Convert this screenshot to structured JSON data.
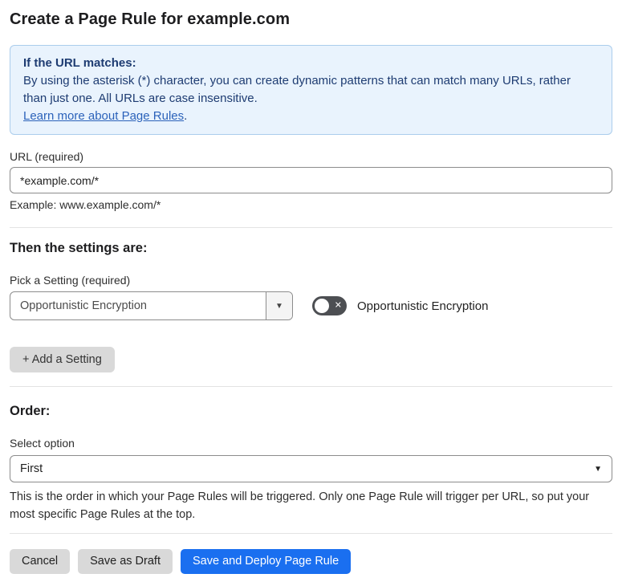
{
  "title": "Create a Page Rule for example.com",
  "info_box": {
    "heading": "If the URL matches:",
    "body": "By using the asterisk (*) character, you can create dynamic patterns that can match many URLs, rather than just one. All URLs are case insensitive.",
    "link_label": "Learn more about Page Rules",
    "link_suffix": "."
  },
  "url_section": {
    "label": "URL (required)",
    "value": "*example.com/*",
    "helper": "Example: www.example.com/*"
  },
  "settings_section": {
    "heading": "Then the settings are:",
    "pick_label": "Pick a Setting (required)",
    "selected_setting": "Opportunistic Encryption",
    "toggle_label": "Opportunistic Encryption",
    "toggle_state": "off",
    "add_button_label": "+ Add a Setting"
  },
  "order_section": {
    "heading": "Order:",
    "label": "Select option",
    "selected": "First",
    "helper": "This is the order in which your Page Rules will be triggered. Only one Page Rule will trigger per URL, so put your most specific Page Rules at the top."
  },
  "footer": {
    "cancel_label": "Cancel",
    "save_draft_label": "Save as Draft",
    "save_deploy_label": "Save and Deploy Page Rule"
  },
  "icons": {
    "dropdown_arrow": "▼",
    "toggle_off_x": "✕"
  },
  "colors": {
    "primary_blue": "#1a6ff0",
    "info_background": "#e9f3fd",
    "info_border": "#abcdec",
    "info_text": "#1e3c72",
    "link_blue": "#2b62ba",
    "gray_button": "#d9d9d9",
    "toggle_off_track": "#4d4f53"
  }
}
